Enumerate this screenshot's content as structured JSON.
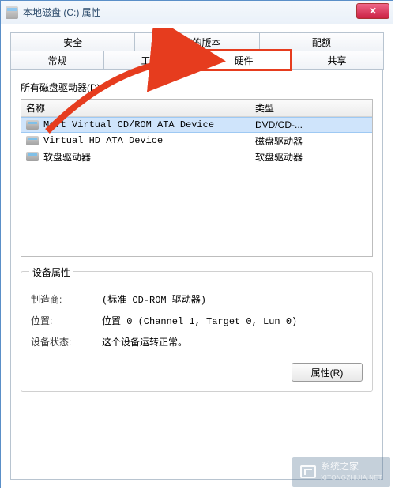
{
  "window": {
    "title": "本地磁盘 (C:) 属性",
    "close": "✕"
  },
  "tabs": {
    "row1": [
      {
        "id": "security",
        "label": "安全"
      },
      {
        "id": "previous",
        "label": "以前的版本"
      },
      {
        "id": "quota",
        "label": "配额"
      }
    ],
    "row2": [
      {
        "id": "general",
        "label": "常规"
      },
      {
        "id": "tools",
        "label": "工具"
      },
      {
        "id": "hardware",
        "label": "硬件",
        "active": true,
        "highlight": true
      },
      {
        "id": "sharing",
        "label": "共享"
      }
    ]
  },
  "hardware": {
    "all_drives_label": "所有磁盘驱动器(D):",
    "columns": {
      "name": "名称",
      "type": "类型"
    },
    "rows": [
      {
        "name": "Msft Virtual CD/ROM ATA Device",
        "type": "DVD/CD-...",
        "selected": true
      },
      {
        "name": "Virtual HD ATA Device",
        "type": "磁盘驱动器"
      },
      {
        "name": "软盘驱动器",
        "type": "软盘驱动器"
      }
    ],
    "props": {
      "legend": "设备属性",
      "manufacturer_label": "制造商:",
      "manufacturer_value": "(标准 CD-ROM 驱动器)",
      "location_label": "位置:",
      "location_value": "位置 0 (Channel 1, Target 0, Lun 0)",
      "status_label": "设备状态:",
      "status_value": "这个设备运转正常。",
      "properties_button": "属性(R)"
    }
  },
  "watermark": {
    "text": "系统之家",
    "sub": "XITONGZHIJIA.NET"
  }
}
